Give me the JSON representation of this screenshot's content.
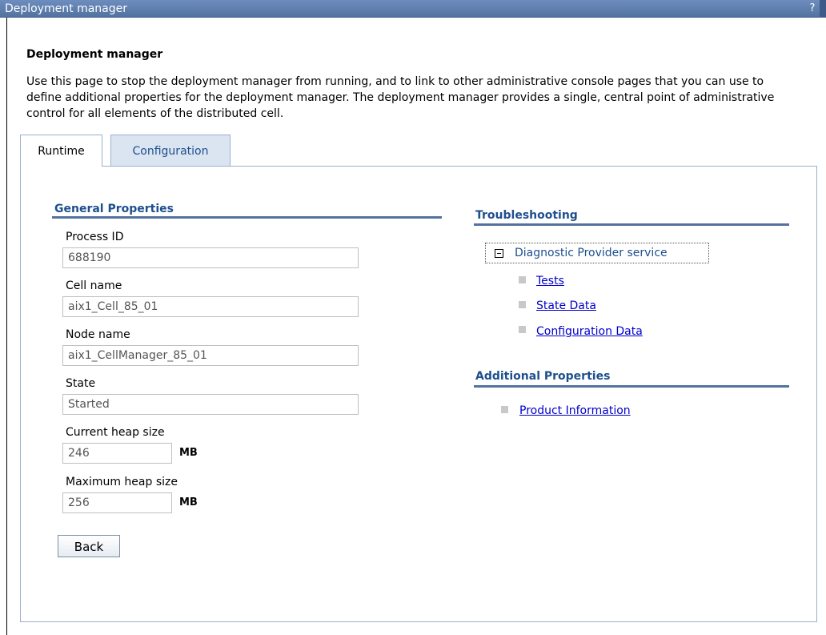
{
  "window": {
    "title": "Deployment manager",
    "help_label": "?"
  },
  "page": {
    "title": "Deployment manager",
    "description": "Use this page to stop the deployment manager from running, and to link to other administrative console pages that you can use to define additional properties for the deployment manager. The deployment manager provides a single, central point of administrative control for all elements of the distributed cell."
  },
  "tabs": {
    "runtime": "Runtime",
    "configuration": "Configuration"
  },
  "general": {
    "heading": "General Properties",
    "process_id": {
      "label": "Process ID",
      "value": "688190"
    },
    "cell_name": {
      "label": "Cell name",
      "value": "aix1_Cell_85_01"
    },
    "node_name": {
      "label": "Node name",
      "value": "aix1_CellManager_85_01"
    },
    "state": {
      "label": "State",
      "value": "Started"
    },
    "current_heap": {
      "label": "Current heap size",
      "value": "246",
      "unit": "MB"
    },
    "max_heap": {
      "label": "Maximum heap size",
      "value": "256",
      "unit": "MB"
    },
    "back_label": "Back"
  },
  "troubleshooting": {
    "heading": "Troubleshooting",
    "tree_label": "Diagnostic Provider service",
    "links": [
      "Tests",
      "State Data",
      "Configuration Data"
    ]
  },
  "additional": {
    "heading": "Additional Properties",
    "links": [
      "Product Information"
    ]
  },
  "colors": {
    "title_bar": "#52739f",
    "heading": "#1d4f8f",
    "link": "#0000cc"
  },
  "icons": {
    "help": "help-icon",
    "collapse": "collapse-icon",
    "bullet": "bullet-icon"
  }
}
